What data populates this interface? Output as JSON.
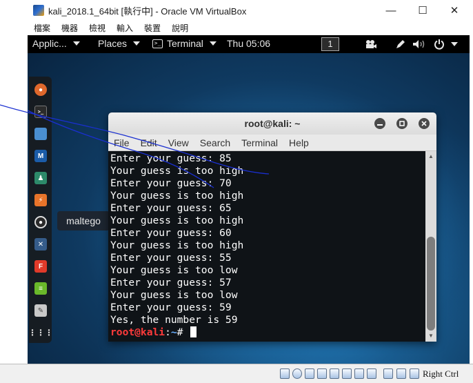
{
  "host_window": {
    "title": "kali_2018.1_64bit [執行中] - Oracle VM VirtualBox",
    "controls": {
      "minimize": "—",
      "maximize": "☐",
      "close": "✕"
    },
    "menu": [
      "檔案",
      "機器",
      "檢視",
      "輸入",
      "裝置",
      "說明"
    ]
  },
  "gnome_top_bar": {
    "applications": "Applic...",
    "places": "Places",
    "active_app": "Terminal",
    "clock": "Thu 05:06",
    "workspace": "1",
    "tray_icons": [
      "video-camera-icon",
      "pen-icon",
      "volume-icon",
      "power-icon"
    ]
  },
  "dock": {
    "icons": [
      "firefox-icon",
      "terminal-icon",
      "files-icon",
      "metasploit-icon",
      "armitage-icon",
      "burpsuite-icon",
      "maltego-icon",
      "beef-icon",
      "faraday-icon",
      "notes-icon",
      "leafpad-icon",
      "show-apps-icon"
    ],
    "tooltip": "maltego"
  },
  "terminal": {
    "title": "root@kali: ~",
    "menu": [
      "File",
      "Edit",
      "View",
      "Search",
      "Terminal",
      "Help"
    ],
    "lines": [
      "Enter your guess: 85",
      "Your guess is too high",
      "Enter your guess: 70",
      "Your guess is too high",
      "Enter your guess: 65",
      "Your guess is too high",
      "Enter your guess: 60",
      "Your guess is too high",
      "Enter your guess: 55",
      "Your guess is too low",
      "Enter your guess: 57",
      "Your guess is too low",
      "Enter your guess: 59",
      "Yes, the number is 59"
    ],
    "prompt": {
      "user_host": "root@kali",
      "sep": ":",
      "path": "~",
      "symbol": "# "
    }
  },
  "status_bar": {
    "host_key": "Right Ctrl",
    "icons": [
      "hdd-icon",
      "cd-icon",
      "usb-icon",
      "shared-folder-icon",
      "pen-icon",
      "display-icon",
      "network-icon",
      "recording-icon",
      "cpu-icon",
      "mouse-icon",
      "arrow-icon"
    ]
  },
  "colors": {
    "prompt_user": "#ff3b3b",
    "prompt_path": "#6ab0ff",
    "terminal_bg": "#0e1216",
    "desktop_accent": "#1b5f94",
    "annotation": "#1a2fd0"
  }
}
